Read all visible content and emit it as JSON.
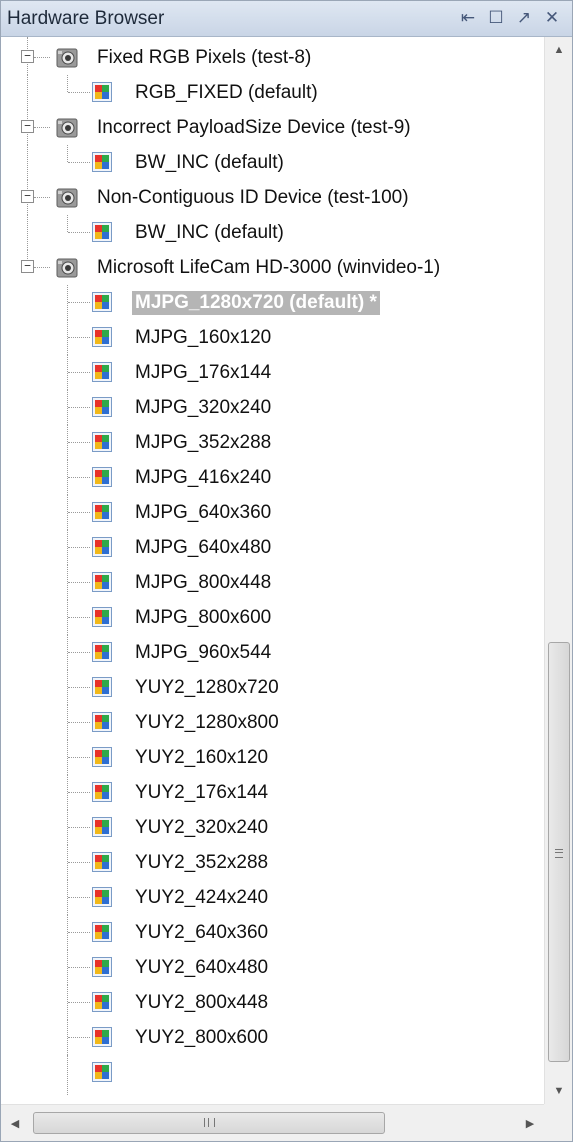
{
  "panel": {
    "title": "Hardware Browser",
    "buttons": [
      {
        "name": "auto-hide-button",
        "glyph": "⇤"
      },
      {
        "name": "maximize-button",
        "glyph": "☐"
      },
      {
        "name": "float-button",
        "glyph": "↗"
      },
      {
        "name": "close-button",
        "glyph": "✕"
      }
    ]
  },
  "tree": {
    "devices": [
      {
        "label": "Fixed RGB Pixels (test-8)",
        "expanded": true,
        "formats": [
          {
            "label": "RGB_FIXED (default)",
            "selected": false
          }
        ]
      },
      {
        "label": "Incorrect PayloadSize Device (test-9)",
        "expanded": true,
        "formats": [
          {
            "label": "BW_INC (default)",
            "selected": false
          }
        ]
      },
      {
        "label": "Non-Contiguous ID Device (test-100)",
        "expanded": true,
        "formats": [
          {
            "label": "BW_INC (default)",
            "selected": false
          }
        ]
      },
      {
        "label": "Microsoft LifeCam HD-3000 (winvideo-1)",
        "expanded": true,
        "formats": [
          {
            "label": "MJPG_1280x720 (default) *",
            "selected": true
          },
          {
            "label": "MJPG_160x120",
            "selected": false
          },
          {
            "label": "MJPG_176x144",
            "selected": false
          },
          {
            "label": "MJPG_320x240",
            "selected": false
          },
          {
            "label": "MJPG_352x288",
            "selected": false
          },
          {
            "label": "MJPG_416x240",
            "selected": false
          },
          {
            "label": "MJPG_640x360",
            "selected": false
          },
          {
            "label": "MJPG_640x480",
            "selected": false
          },
          {
            "label": "MJPG_800x448",
            "selected": false
          },
          {
            "label": "MJPG_800x600",
            "selected": false
          },
          {
            "label": "MJPG_960x544",
            "selected": false
          },
          {
            "label": "YUY2_1280x720",
            "selected": false
          },
          {
            "label": "YUY2_1280x800",
            "selected": false
          },
          {
            "label": "YUY2_160x120",
            "selected": false
          },
          {
            "label": "YUY2_176x144",
            "selected": false
          },
          {
            "label": "YUY2_320x240",
            "selected": false
          },
          {
            "label": "YUY2_352x288",
            "selected": false
          },
          {
            "label": "YUY2_424x240",
            "selected": false
          },
          {
            "label": "YUY2_640x360",
            "selected": false
          },
          {
            "label": "YUY2_640x480",
            "selected": false
          },
          {
            "label": "YUY2_800x448",
            "selected": false
          },
          {
            "label": "YUY2_800x600",
            "selected": false
          }
        ]
      }
    ]
  },
  "scrollbars": {
    "vertical_arrow_up": "▲",
    "vertical_arrow_down": "▼",
    "horizontal_arrow_left": "◀",
    "horizontal_arrow_right": "▶"
  }
}
